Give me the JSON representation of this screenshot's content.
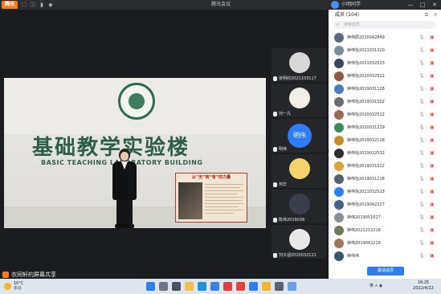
{
  "titlebar": {
    "app_logo": "腾讯",
    "title": "腾讯会议",
    "user_name": "小明同学",
    "icons": [
      "fullscreen-icon",
      "info-icon",
      "signal-icon",
      "shield-icon"
    ],
    "window_buttons": [
      "—",
      "□",
      "✕"
    ]
  },
  "main": {
    "building_cn": "基础教学实验楼",
    "building_en": "BASIC TEACHING LABORATORY BUILDING",
    "poster_title": "从“无”到“有”的力量",
    "share_label": "衣同轩的屏幕共享"
  },
  "tiles": [
    {
      "label": "张明欣2021103117"
    },
    {
      "label": "刘一凡"
    },
    {
      "label": "明伟",
      "avatar_text": "明伟"
    },
    {
      "label": "何华"
    },
    {
      "label": "陈伟2019036"
    },
    {
      "label": "刘子涵2020032121"
    }
  ],
  "panel": {
    "title": "成员 (104)",
    "search_placeholder": "搜索成员",
    "members": [
      {
        "name": "钟伟辰2020042849",
        "color": "#5b6b7a"
      },
      {
        "name": "钟伟怡2021031320",
        "color": "#7a8c9e"
      },
      {
        "name": "钟伟怡2021032523",
        "color": "#3a4756"
      },
      {
        "name": "钟伟怡2020032512",
        "color": "#8c5a3c"
      },
      {
        "name": "钟伟怡2019031128",
        "color": "#4a7cc4"
      },
      {
        "name": "钟伟怡2019031502",
        "color": "#6d6d6d"
      },
      {
        "name": "钟伟怡2020032512",
        "color": "#9a6b4f"
      },
      {
        "name": "钟伟怡2020031219",
        "color": "#3d8b5a"
      },
      {
        "name": "钟伟怡2019032118",
        "color": "#c98a2d"
      },
      {
        "name": "钟伟怡2019032532",
        "color": "#2f2f33"
      },
      {
        "name": "钟伟怡2019031512",
        "color": "#d9a23a"
      },
      {
        "name": "钟伟怡2019031218",
        "color": "#57606e"
      },
      {
        "name": "钟伟怡2021032513",
        "color": "#2e7cf6"
      },
      {
        "name": "钟伟怡2019042327",
        "color": "#4a5f8a"
      },
      {
        "name": "钟伟2019051627",
        "color": "#8a8f96"
      },
      {
        "name": "钟伟2021212218",
        "color": "#6e7a5a"
      },
      {
        "name": "钟伟2019042219",
        "color": "#a07858"
      },
      {
        "name": "钟伟伟",
        "color": "#3c5470"
      }
    ],
    "footer_button": "邀请成员"
  },
  "taskbar": {
    "temp": "16°C",
    "weather": "多云",
    "tray": "英 ∧ ◉",
    "time": "16:25",
    "date": "2022/4/22",
    "apps": [
      "windows-start",
      "search",
      "task-view",
      "file-explorer",
      "browser",
      "store",
      "mail",
      "wps",
      "meeting",
      "notes",
      "settings",
      "pictures"
    ]
  }
}
